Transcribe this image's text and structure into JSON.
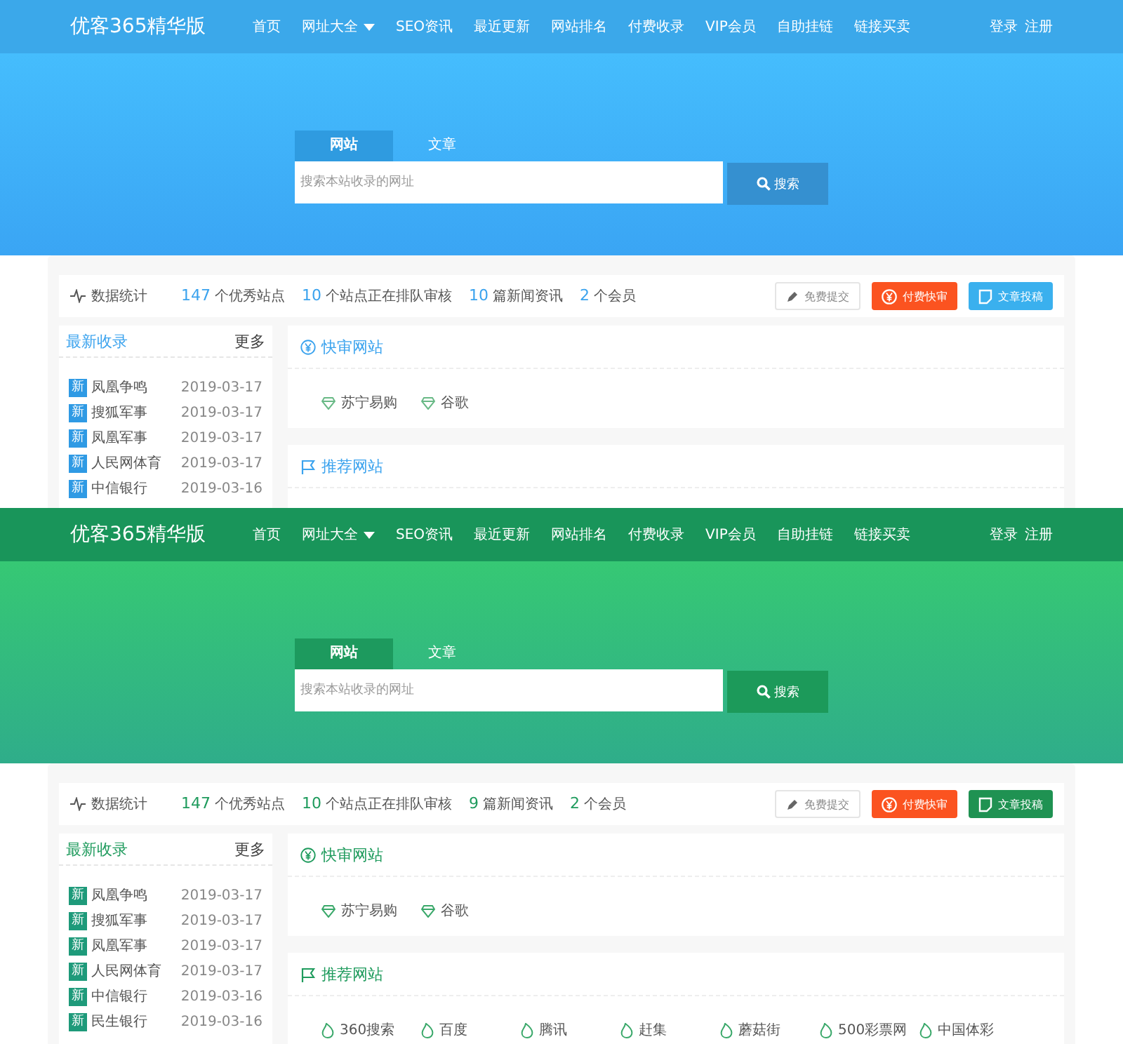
{
  "panels": [
    {
      "kind": "blue",
      "brand": "优客365精华版",
      "nav": [
        {
          "label": "首页",
          "dropdown": false
        },
        {
          "label": "网址大全",
          "dropdown": true
        },
        {
          "label": "SEO资讯",
          "dropdown": false
        },
        {
          "label": "最近更新",
          "dropdown": false
        },
        {
          "label": "网站排名",
          "dropdown": false
        },
        {
          "label": "付费收录",
          "dropdown": false
        },
        {
          "label": "VIP会员",
          "dropdown": false
        },
        {
          "label": "自助挂链",
          "dropdown": false
        },
        {
          "label": "链接买卖",
          "dropdown": false
        }
      ],
      "account": [
        "登录",
        "注册"
      ],
      "search": {
        "tabs": [
          {
            "label": "网站",
            "selected": true
          },
          {
            "label": "文章",
            "selected": false
          }
        ],
        "placeholder": "搜索本站收录的网址",
        "button": "搜索"
      },
      "stats": {
        "title": "数据统计",
        "items": [
          {
            "count": "147",
            "text": "个优秀站点"
          },
          {
            "count": "10",
            "text": "个站点正在排队审核"
          },
          {
            "count": "10",
            "text": "篇新闻资讯"
          },
          {
            "count": "2",
            "text": "个会员"
          }
        ]
      },
      "actions": [
        {
          "label": "免费提交",
          "kind": "plain"
        },
        {
          "label": "付费快审",
          "kind": "paid"
        },
        {
          "label": "文章投稿",
          "kind": "post"
        }
      ],
      "latest": {
        "title": "最新收录",
        "more": "更多",
        "items": [
          {
            "badge": "新",
            "name": "凤凰争鸣",
            "date": "2019-03-17"
          },
          {
            "badge": "新",
            "name": "搜狐军事",
            "date": "2019-03-17"
          },
          {
            "badge": "新",
            "name": "凤凰军事",
            "date": "2019-03-17"
          },
          {
            "badge": "新",
            "name": "人民网体育",
            "date": "2019-03-17"
          },
          {
            "badge": "新",
            "name": "中信银行",
            "date": "2019-03-16"
          }
        ]
      },
      "sections": [
        {
          "title": "快审网站",
          "kind": "fast",
          "links": [
            "苏宁易购",
            "谷歌"
          ]
        },
        {
          "title": "推荐网站",
          "kind": "recommend"
        }
      ]
    },
    {
      "kind": "green",
      "brand": "优客365精华版",
      "nav": [
        {
          "label": "首页",
          "dropdown": false
        },
        {
          "label": "网址大全",
          "dropdown": true
        },
        {
          "label": "SEO资讯",
          "dropdown": false
        },
        {
          "label": "最近更新",
          "dropdown": false
        },
        {
          "label": "网站排名",
          "dropdown": false
        },
        {
          "label": "付费收录",
          "dropdown": false
        },
        {
          "label": "VIP会员",
          "dropdown": false
        },
        {
          "label": "自助挂链",
          "dropdown": false
        },
        {
          "label": "链接买卖",
          "dropdown": false
        }
      ],
      "account": [
        "登录",
        "注册"
      ],
      "search": {
        "tabs": [
          {
            "label": "网站",
            "selected": true
          },
          {
            "label": "文章",
            "selected": false
          }
        ],
        "placeholder": "搜索本站收录的网址",
        "button": "搜索"
      },
      "stats": {
        "title": "数据统计",
        "items": [
          {
            "count": "147",
            "text": "个优秀站点"
          },
          {
            "count": "10",
            "text": "个站点正在排队审核"
          },
          {
            "count": "9",
            "text": "篇新闻资讯"
          },
          {
            "count": "2",
            "text": "个会员"
          }
        ]
      },
      "actions": [
        {
          "label": "免费提交",
          "kind": "plain"
        },
        {
          "label": "付费快审",
          "kind": "paid"
        },
        {
          "label": "文章投稿",
          "kind": "post"
        }
      ],
      "latest": {
        "title": "最新收录",
        "more": "更多",
        "items": [
          {
            "badge": "新",
            "name": "凤凰争鸣",
            "date": "2019-03-17"
          },
          {
            "badge": "新",
            "name": "搜狐军事",
            "date": "2019-03-17"
          },
          {
            "badge": "新",
            "name": "凤凰军事",
            "date": "2019-03-17"
          },
          {
            "badge": "新",
            "name": "人民网体育",
            "date": "2019-03-17"
          },
          {
            "badge": "新",
            "name": "中信银行",
            "date": "2019-03-16"
          },
          {
            "badge": "新",
            "name": "民生银行",
            "date": "2019-03-16"
          }
        ]
      },
      "sections": [
        {
          "title": "快审网站",
          "kind": "fast",
          "links": [
            "苏宁易购",
            "谷歌"
          ]
        },
        {
          "title": "推荐网站",
          "kind": "recommend",
          "links": [
            "360搜索",
            "百度",
            "腾讯",
            "赶集",
            "蘑菇街",
            "500彩票网",
            "中国体彩"
          ]
        }
      ]
    }
  ]
}
